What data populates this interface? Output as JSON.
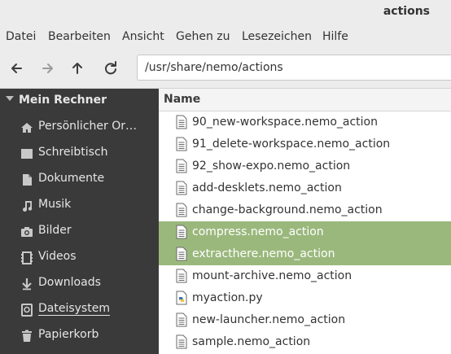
{
  "window": {
    "title": "actions"
  },
  "menu": [
    "Datei",
    "Bearbeiten",
    "Ansicht",
    "Gehen zu",
    "Lesezeichen",
    "Hilfe"
  ],
  "toolbar": {
    "back_icon": "arrow-left-icon",
    "forward_icon": "arrow-right-icon",
    "up_icon": "arrow-up-icon",
    "reload_icon": "reload-icon",
    "path": "/usr/share/nemo/actions"
  },
  "sidebar": {
    "header": "Mein Rechner",
    "items": [
      {
        "label": "Persönlicher Or…",
        "icon": "home-icon"
      },
      {
        "label": "Schreibtisch",
        "icon": "desktop-icon"
      },
      {
        "label": "Dokumente",
        "icon": "document-icon"
      },
      {
        "label": "Musik",
        "icon": "music-icon"
      },
      {
        "label": "Bilder",
        "icon": "camera-icon"
      },
      {
        "label": "Videos",
        "icon": "film-icon"
      },
      {
        "label": "Downloads",
        "icon": "download-icon"
      },
      {
        "label": "Dateisystem",
        "icon": "drive-icon"
      },
      {
        "label": "Papierkorb",
        "icon": "trash-icon"
      }
    ]
  },
  "files": {
    "column_name": "Name",
    "rows": [
      {
        "name": "90_new-workspace.nemo_action",
        "type": "text"
      },
      {
        "name": "91_delete-workspace.nemo_action",
        "type": "text"
      },
      {
        "name": "92_show-expo.nemo_action",
        "type": "text"
      },
      {
        "name": "add-desklets.nemo_action",
        "type": "text"
      },
      {
        "name": "change-background.nemo_action",
        "type": "text"
      },
      {
        "name": "compress.nemo_action",
        "type": "text"
      },
      {
        "name": "extracthere.nemo_action",
        "type": "text"
      },
      {
        "name": "mount-archive.nemo_action",
        "type": "text"
      },
      {
        "name": "myaction.py",
        "type": "python"
      },
      {
        "name": "new-launcher.nemo_action",
        "type": "text"
      },
      {
        "name": "sample.nemo_action",
        "type": "text"
      }
    ],
    "selected": [
      "compress.nemo_action",
      "extracthere.nemo_action"
    ]
  },
  "colors": {
    "selection": "#9ab87c",
    "sidebar_bg": "#3a3a3a",
    "chrome_bg": "#ececec"
  }
}
